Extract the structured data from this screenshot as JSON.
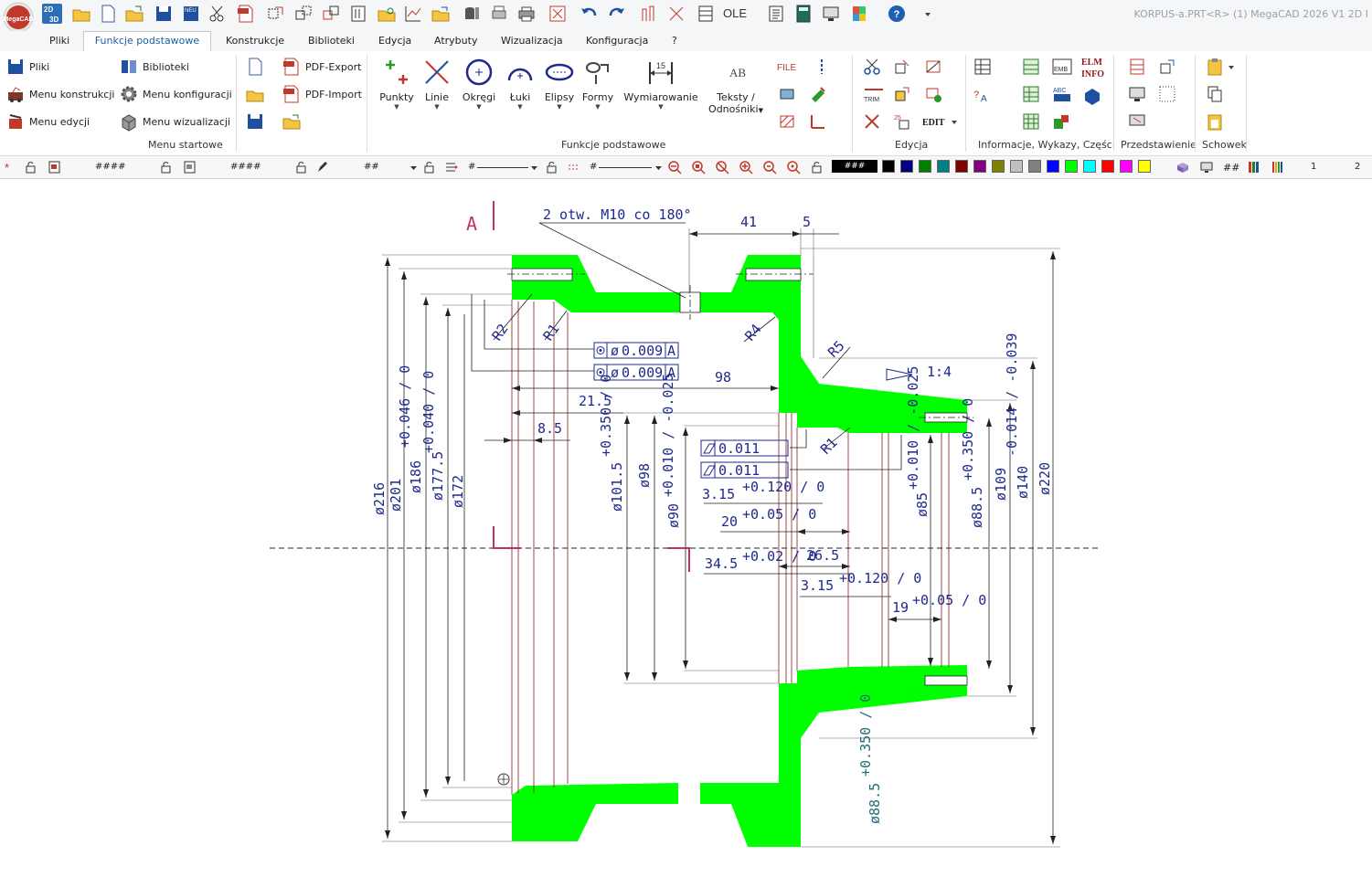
{
  "window": {
    "title": "KORPUS-a.PRT<R> (1) MegaCAD 2026 V1 2D I",
    "logo_text": "MegaCAD"
  },
  "qat": {
    "mode_label": "2D/3D",
    "neu_label": "NEU",
    "ole_label": "OLE",
    "help_label": "?"
  },
  "tabs": [
    "Pliki",
    "Funkcje podstawowe",
    "Konstrukcje",
    "Biblioteki",
    "Edycja",
    "Atrybuty",
    "Wizualizacja",
    "Konfiguracja",
    "?"
  ],
  "ribbon": {
    "start": {
      "pliki": "Pliki",
      "menu_konstrukcji": "Menu konstrukcji",
      "menu_edycji": "Menu edycji",
      "biblioteki": "Biblioteki",
      "menu_konfiguracji": "Menu konfiguracji",
      "menu_wizualizacji": "Menu wizualizacji",
      "group": "Menu startowe"
    },
    "pdf_export": "PDF-Export",
    "pdf_import": "PDF-Import",
    "basic": {
      "punkty": "Punkty",
      "linie": "Linie",
      "okregi": "Okręgi",
      "luki": "Łuki",
      "elipsy": "Elipsy",
      "formy": "Formy",
      "wymiarowanie": "Wymiarowanie",
      "teksty": "Teksty /",
      "odnosniki": "Odnośniki",
      "group": "Funkcje podstawowe"
    },
    "edit": {
      "file": "FILE",
      "trim": "TRIM",
      "edit_label": "EDIT",
      "group": "Edycja"
    },
    "info": {
      "emb": "EMB",
      "elm": "ELM",
      "info": "INFO",
      "abc": "ABC",
      "group": "Informacje, Wykazy, Części"
    },
    "view": {
      "group": "Przedstawienie"
    },
    "clip": {
      "group": "Schowek"
    }
  },
  "propbar": {
    "f1": "####",
    "f2": "####",
    "f3": "##",
    "f4": "#",
    "f5": "#",
    "color_field": "###",
    "hash_btn": "##",
    "page_a": "1",
    "page_b": "2",
    "palette": [
      "#000000",
      "#000080",
      "#008000",
      "#008080",
      "#800000",
      "#800080",
      "#808000",
      "#c0c0c0",
      "#808080",
      "#0000ff",
      "#00ff00",
      "#00ffff",
      "#ff0000",
      "#ff00ff",
      "#ffff00"
    ]
  },
  "drawing": {
    "section_label": "A",
    "callout": "2 otw. M10 co 180°",
    "taper": "1:4",
    "dims": {
      "d41": "41",
      "d5": "5",
      "d98h": "98",
      "d215": "21.5",
      "d85": "8.5",
      "r2": "R2",
      "r1a": "R1",
      "r4": "R4",
      "r5": "R5",
      "r1b": "R1",
      "tol1": "0.009",
      "tol2": "0.009",
      "tol3": "0.011",
      "tol4": "0.011",
      "datum": "A",
      "d315a": "3.15",
      "d315a_tol": "+0.120 / 0",
      "d20": "20",
      "d20_tol": "+0.05 / 0",
      "d345": "34.5",
      "d345_tol": "+0.02 / 0",
      "d265": "26.5",
      "d315b": "3.15",
      "d315b_tol": "+0.120 / 0",
      "d19": "19",
      "d19_tol": "+0.05 / 0",
      "o216": "ø216",
      "o201": "ø201",
      "o186": "ø186",
      "o186_tol": "+0.046 / 0",
      "o1775": "ø177.5",
      "o1775_tol": "+0.040 / 0",
      "o172": "ø172",
      "o1015": "ø101.5",
      "o1015_tol": "+0.350 / 0",
      "o98": "ø98",
      "o90": "ø90",
      "o90_tol": "+0.010 / -0.025",
      "o85": "ø85",
      "o85_tol": "+0.010 / -0.025",
      "o885a": "ø88.5",
      "o885a_tol": "+0.350 / 0",
      "o109": "ø109",
      "o140": "ø140",
      "o140_tol": "-0.014 / -0.039",
      "o220": "ø220",
      "o885b": "ø88.5",
      "o885b_tol": "+0.350 / 0"
    }
  }
}
